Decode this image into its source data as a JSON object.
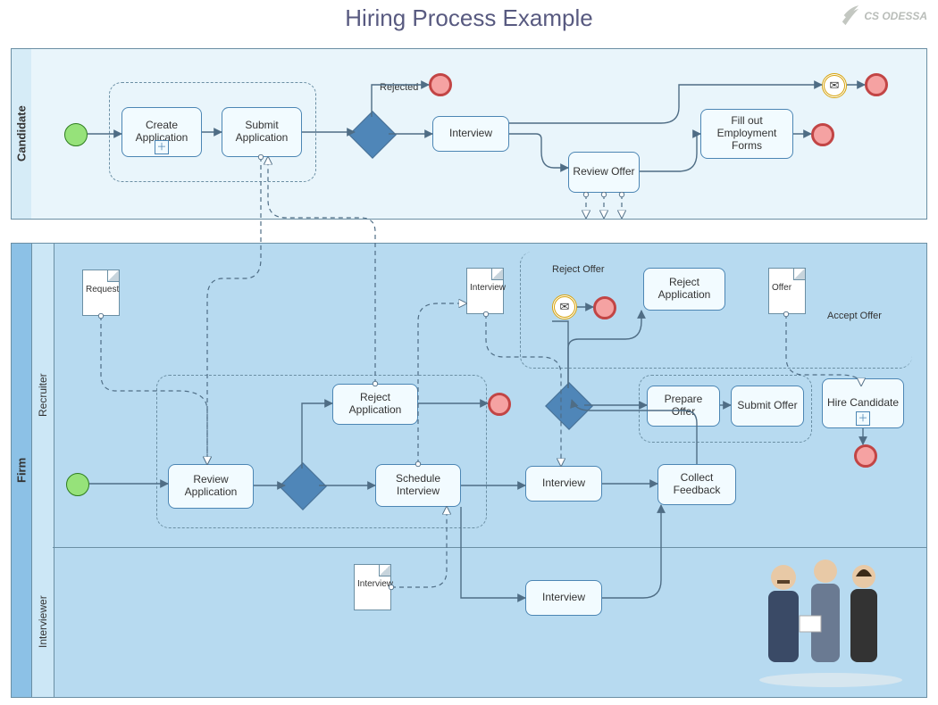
{
  "title": "Hiring Process Example",
  "logo": "CS ODESSA",
  "pools": {
    "candidate": {
      "label": "Candidate"
    },
    "firm": {
      "label": "Firm",
      "lanes": {
        "recruiter": "Recruiter",
        "interviewer": "Interviewer"
      }
    }
  },
  "tasks": {
    "create_app": "Create Application",
    "submit_app": "Submit Application",
    "interview_cand": "Interview",
    "review_offer": "Review Offer",
    "fill_forms": "Fill out Employment Forms",
    "reject_app_recruiter": "Reject Application",
    "review_app": "Review Application",
    "schedule_int": "Schedule Interview",
    "interview_recruiter": "Interview",
    "collect_feedback": "Collect Feedback",
    "prepare_offer": "Prepare Offer",
    "submit_offer": "Submit Offer",
    "reject_app_cand": "Reject Application",
    "hire_candidate": "Hire Candidate",
    "interview_interviewer": "Interview"
  },
  "labels": {
    "rejected": "Rejected",
    "reject_offer": "Reject Offer",
    "accept_offer": "Accept Offer"
  },
  "docs": {
    "request": "Request",
    "interview1": "Interview",
    "interview2": "Interview",
    "offer": "Offer"
  },
  "icons": {
    "envelope": "✉"
  }
}
